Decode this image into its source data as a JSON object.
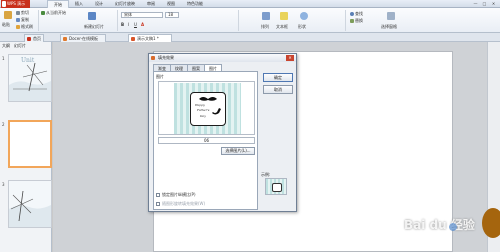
{
  "titlebar": {
    "app_name": "WPS 演示",
    "menu": [
      "开始",
      "插入",
      "设计",
      "幻灯片放映",
      "审阅",
      "视图",
      "特色功能"
    ],
    "active_menu": 0,
    "window_controls": [
      "—",
      "□",
      "✕"
    ]
  },
  "ribbon": {
    "paste": "粘贴",
    "cut": "剪切",
    "copy": "复制",
    "format_painter": "格式刷",
    "from_current": "从当前开始",
    "new_slide": "新建幻灯片",
    "font_name": "宋体",
    "font_size": "18",
    "arrange": "排列",
    "textbox": "文本框",
    "shape": "形状",
    "find": "查找",
    "replace": "替换",
    "select_window": "选择窗格"
  },
  "tabs": {
    "home": "首页",
    "template": "Docer-在线模板",
    "document": "演示文稿1 *"
  },
  "left_panel": {
    "outline_tab": "大纲",
    "slides_tab": "幻灯片",
    "slide_numbers": [
      "1",
      "2",
      "3"
    ],
    "slide1_caption": "Unit"
  },
  "dialog": {
    "title": "填充效果",
    "close": "✕",
    "tabs": [
      "渐变",
      "纹理",
      "图案",
      "图片"
    ],
    "active_tab": 3,
    "picture_label": "图片",
    "filename": "06",
    "choose_button": "选择图片(L)...",
    "ok": "确定",
    "cancel": "取消",
    "sample_label": "示例:",
    "lock_ratio": "锁定图片纵横比(P)",
    "rotate_with_shape": "随图形旋转填充效果(W)",
    "card_text": [
      "Happy",
      "Father's",
      "Day"
    ],
    "colors": {
      "stripe_light": "#e4f3f2",
      "stripe_dark": "#bfe1e0"
    }
  },
  "watermark": "Bai du 经验",
  "accent": "#c9301b"
}
